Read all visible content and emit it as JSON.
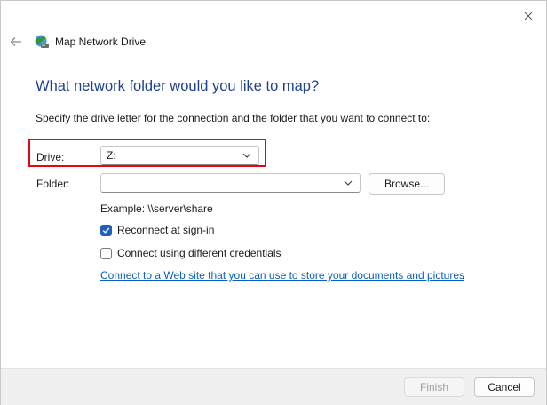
{
  "window": {
    "title": "Map Network Drive",
    "close_icon": "close-icon",
    "back_icon": "arrow-left-icon"
  },
  "main": {
    "heading": "What network folder would you like to map?",
    "instructions": "Specify the drive letter for the connection and the folder that you want to connect to:",
    "drive": {
      "label": "Drive:",
      "value": "Z:"
    },
    "folder": {
      "label": "Folder:",
      "value": "",
      "browse_label": "Browse..."
    },
    "example": "Example: \\\\server\\share",
    "reconnect": {
      "label": "Reconnect at sign-in",
      "checked": true
    },
    "different_credentials": {
      "label": "Connect using different credentials",
      "checked": false
    },
    "link_text": "Connect to a Web site that you can use to store your documents and pictures",
    "link_suffix": "."
  },
  "footer": {
    "finish_label": "Finish",
    "cancel_label": "Cancel"
  },
  "colors": {
    "heading": "#1f3f8f",
    "link": "#0a5ec5",
    "highlight": "#e30613",
    "checkbox_checked": "#1f5fbf"
  }
}
